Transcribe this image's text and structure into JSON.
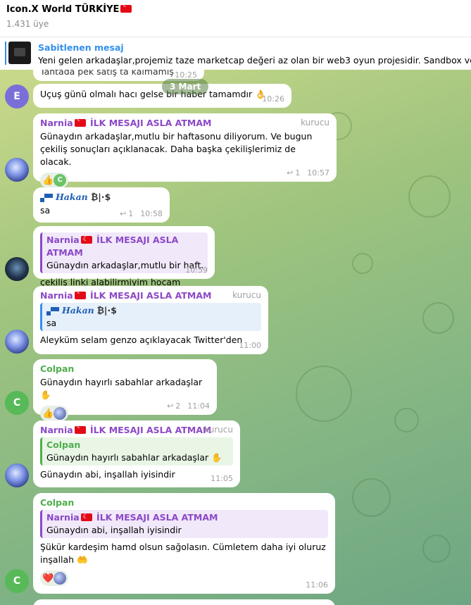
{
  "header": {
    "title": "Icon.X World TÜRKİYE",
    "title_flag": "turkey-flag",
    "members": "1.431 üye"
  },
  "pinned": {
    "title": "Sabitlenen mesaj",
    "text": "Yeni gelen arkadaşlar,projemiz taze marketcap değeri az olan bir web3 oyun projesidir. Sandbox ve Alpin"
  },
  "date_pill": "3 Mart",
  "messages": [
    {
      "text": "Tahtada pek satış ta kalmamış",
      "time": "10:25"
    },
    {
      "avatar": "E",
      "text": "Uçuş günü olmalı hacı gelse bir haber tamamdır 👌",
      "time": "10:26"
    },
    {
      "sender": "Narnia",
      "sender_suffix": "İLK MESAJI ASLA ATMAM",
      "role": "kurucu",
      "text": "Günaydın arkadaşlar,mutlu bir haftasonu diliyorum. Ve bugun çekiliş sonuçları açıklanacak. Daha başka çekilişlerimiz de olacak.",
      "reactions": [
        "👍",
        "C"
      ],
      "replies": "1",
      "time": "10:57"
    },
    {
      "sender": "Hakan",
      "sender_symbols": "₿|·$",
      "text": "sa",
      "replies": "1",
      "time": "10:58"
    },
    {
      "quote_sender": "Narnia",
      "quote_suffix": "İLK MESAJI ASLA ATMAM",
      "quote_text": "Günaydın arkadaşlar,mutlu bir haft...",
      "text": "çekiliş linki alabilirmiyim hocam",
      "time": "10:59"
    },
    {
      "sender": "Narnia",
      "sender_suffix": "İLK MESAJI ASLA ATMAM",
      "role": "kurucu",
      "quote_sender": "Hakan",
      "quote_symbols": "₿|·$",
      "quote_text": "sa",
      "text": "Aleyküm selam genzo açıklayacak Twitter'den",
      "time": "11:00"
    },
    {
      "sender": "Colpan",
      "text": "Günaydın hayırlı sabahlar arkadaşlar ✋",
      "reactions": [
        "👍",
        "bot"
      ],
      "replies": "2",
      "time": "11:04",
      "avatar": "C"
    },
    {
      "sender": "Narnia",
      "sender_suffix": "İLK MESAJI ASLA ATMAM",
      "role": "kurucu",
      "quote_sender": "Colpan",
      "quote_text": "Günaydın hayırlı sabahlar arkadaşlar ✋",
      "text": "Günaydın abi, inşallah iyisindir",
      "time": "11:05"
    },
    {
      "sender": "Colpan",
      "quote_sender": "Narnia",
      "quote_suffix": "İLK MESAJI ASLA ATMAM",
      "quote_text": "Günaydın abi, inşallah iyisindir",
      "text": "Şükür kardeşim hamd olsun sağolasın. Cümletem daha iyi oluruz inşallah 🤲",
      "reactions": [
        "❤️",
        "bot"
      ],
      "time": "11:06",
      "avatar": "C"
    }
  ]
}
